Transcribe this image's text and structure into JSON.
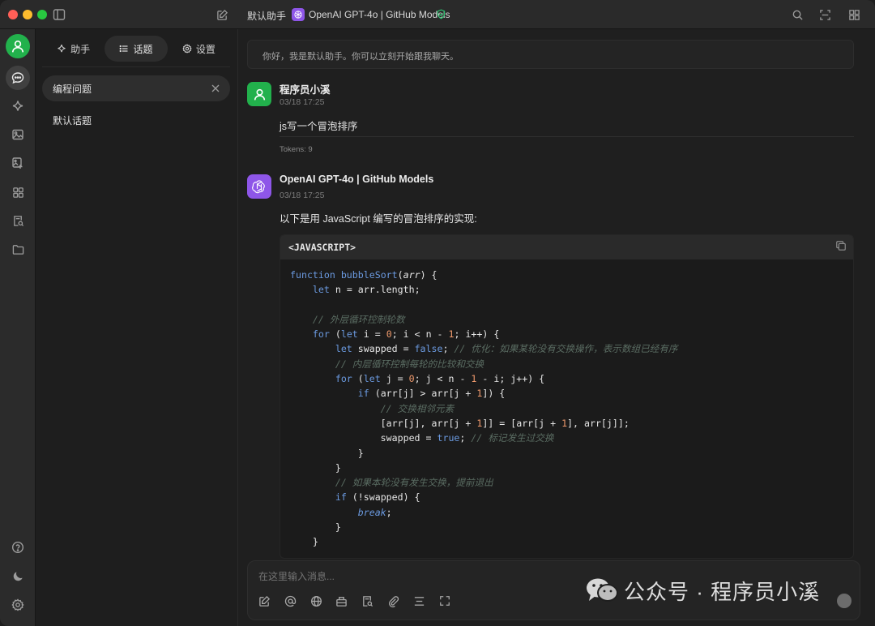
{
  "titlebar": {
    "assistant_label": "默认助手",
    "model_label": "OpenAI GPT-4o | GitHub Models"
  },
  "panel": {
    "tabs": [
      {
        "label": "助手",
        "icon": "sparkle-icon"
      },
      {
        "label": "话题",
        "icon": "list-icon"
      },
      {
        "label": "设置",
        "icon": "gear-icon"
      }
    ],
    "active_tab": "话题",
    "topics": [
      {
        "label": "编程问题",
        "active": true
      },
      {
        "label": "默认话题",
        "active": false
      }
    ]
  },
  "chat": {
    "greeting": "你好，我是默认助手。你可以立刻开始跟我聊天。",
    "user_message": {
      "name": "程序员小溪",
      "time": "03/18 17:25",
      "text": "js写一个冒泡排序",
      "tokens": "Tokens: 9"
    },
    "assistant_message": {
      "name": "OpenAI GPT-4o | GitHub Models",
      "time": "03/18 17:25",
      "intro": "以下是用 JavaScript 编写的冒泡排序的实现:",
      "code_lang": "<JAVASCRIPT>",
      "code_lines": [
        "function bubbleSort(arr) {",
        "    let n = arr.length;",
        "",
        "    // 外层循环控制轮数",
        "    for (let i = 0; i < n - 1; i++) {",
        "        let swapped = false; // 优化：如果某轮没有交换操作，表示数组已经有序",
        "        // 内层循环控制每轮的比较和交换",
        "        for (let j = 0; j < n - 1 - i; j++) {",
        "            if (arr[j] > arr[j + 1]) {",
        "                // 交换相邻元素",
        "                [arr[j], arr[j + 1]] = [arr[j + 1], arr[j]];",
        "                swapped = true; // 标记发生过交换",
        "            }",
        "        }",
        "        // 如果本轮没有发生交换，提前退出",
        "        if (!swapped) {",
        "            break;",
        "        }",
        "    }"
      ]
    }
  },
  "input": {
    "placeholder": "在这里输入消息..."
  },
  "watermark": {
    "text": "公众号 · 程序员小溪"
  },
  "colors": {
    "user_avatar": "#22b14c",
    "assistant_avatar": "#8e56e8",
    "code_keyword": "#6b9ae0",
    "code_number": "#f09a6c",
    "code_comment": "#5a6c62"
  }
}
